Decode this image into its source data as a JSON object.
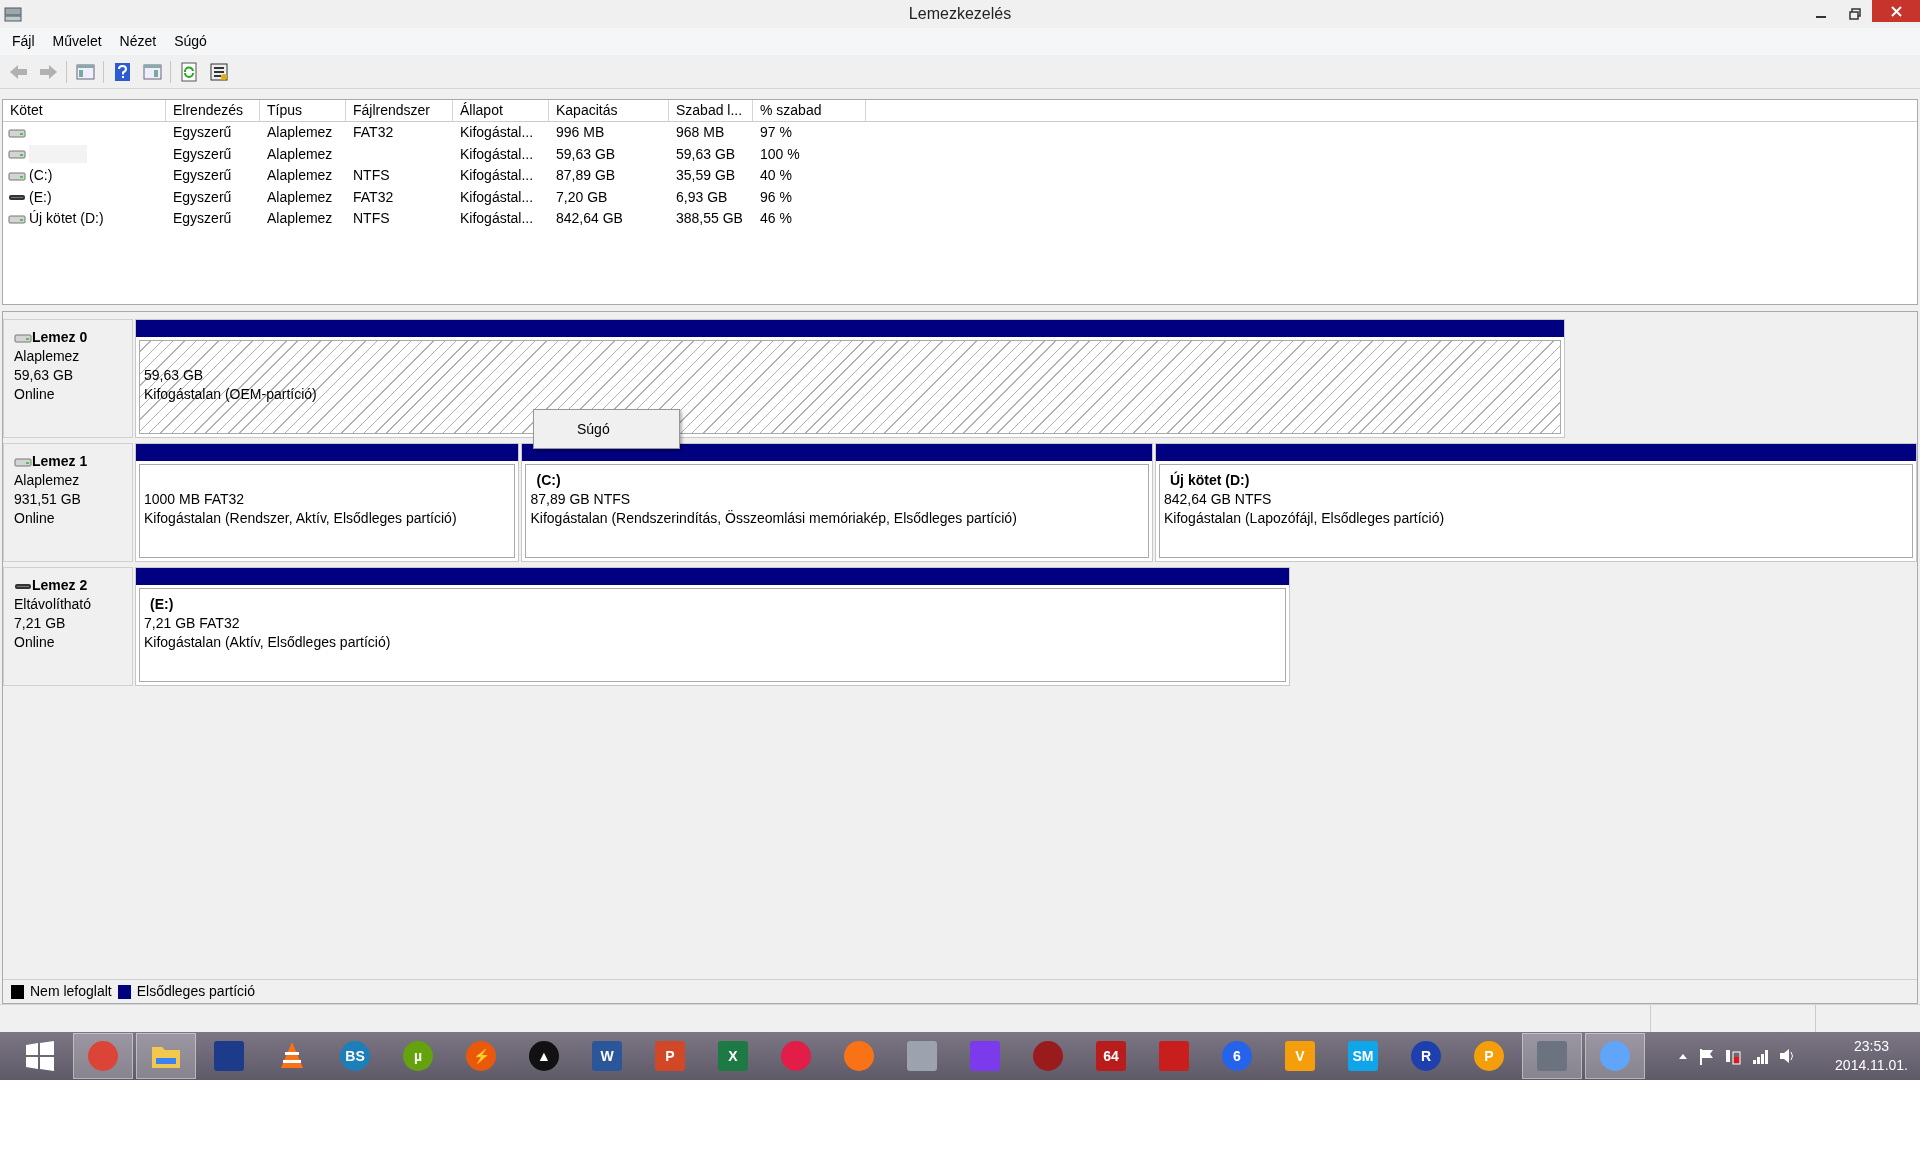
{
  "window": {
    "title": "Lemezkezelés"
  },
  "menu": [
    "Fájl",
    "Művelet",
    "Nézet",
    "Súgó"
  ],
  "toolbar": [
    {
      "kind": "back",
      "disabled": true
    },
    {
      "kind": "forward",
      "disabled": true
    },
    {
      "kind": "sep"
    },
    {
      "kind": "panel"
    },
    {
      "kind": "sep"
    },
    {
      "kind": "help"
    },
    {
      "kind": "panel2"
    },
    {
      "kind": "sep"
    },
    {
      "kind": "refresh"
    },
    {
      "kind": "properties"
    }
  ],
  "table": {
    "columns": [
      "Kötet",
      "Elrendezés",
      "Típus",
      "Fájlrendszer",
      "Állapot",
      "Kapacitás",
      "Szabad l...",
      "% szabad"
    ],
    "rows": [
      {
        "kind": "hdd",
        "redacted": false,
        "cells": [
          "",
          "Egyszerű",
          "Alaplemez",
          "FAT32",
          "Kifogástal...",
          "996 MB",
          "968 MB",
          "97 %"
        ]
      },
      {
        "kind": "hdd",
        "redacted": true,
        "cells": [
          "",
          "Egyszerű",
          "Alaplemez",
          "",
          "Kifogástal...",
          "59,63 GB",
          "59,63 GB",
          "100 %"
        ]
      },
      {
        "kind": "hdd",
        "redacted": false,
        "cells": [
          "(C:)",
          "Egyszerű",
          "Alaplemez",
          "NTFS",
          "Kifogástal...",
          "87,89 GB",
          "35,59 GB",
          "40 %"
        ]
      },
      {
        "kind": "removable",
        "redacted": false,
        "cells": [
          "(E:)",
          "Egyszerű",
          "Alaplemez",
          "FAT32",
          "Kifogástal...",
          "7,20 GB",
          "6,93 GB",
          "96 %"
        ]
      },
      {
        "kind": "hdd",
        "redacted": false,
        "cells": [
          "Új kötet (D:)",
          "Egyszerű",
          "Alaplemez",
          "NTFS",
          "Kifogástal...",
          "842,64 GB",
          "388,55 GB",
          "46 %"
        ]
      }
    ]
  },
  "disks": [
    {
      "kind": "hdd",
      "name": "Lemez 0",
      "type": "Alaplemez",
      "size": "59,63 GB",
      "status": "Online",
      "partitions": [
        {
          "selected": true,
          "size": "59,63 GB",
          "status": "Kifogástalan (OEM-partíció)"
        }
      ]
    },
    {
      "kind": "hdd",
      "name": "Lemez 1",
      "type": "Alaplemez",
      "size": "931,51 GB",
      "status": "Online",
      "partitions": [
        {
          "selected": false,
          "size": "1000 MB FAT32",
          "status": "Kifogástalan (Rendszer, Aktív, Elsődleges partíció)"
        },
        {
          "selected": false,
          "title": "(C:)",
          "size": "87,89 GB NTFS",
          "status": "Kifogástalan (Rendszerindítás, Összeomlási memóriakép, Elsődleges partíció)"
        },
        {
          "selected": false,
          "title": "Új kötet  (D:)",
          "size": "842,64 GB NTFS",
          "status": "Kifogástalan (Lapozófájl, Elsődleges partíció)"
        }
      ]
    },
    {
      "kind": "removable",
      "name": "Lemez 2",
      "type": "Eltávolítható",
      "size": "7,21 GB",
      "status": "Online",
      "partitions": [
        {
          "selected": false,
          "title": "(E:)",
          "size": "7,21 GB FAT32",
          "status": "Kifogástalan (Aktív, Elsődleges partíció)"
        }
      ]
    }
  ],
  "context_menu": {
    "items": [
      "Súgó"
    ]
  },
  "legend": [
    {
      "label": "Nem lefoglalt",
      "color": "#000000"
    },
    {
      "label": "Elsődleges partíció",
      "color": "#000080"
    }
  ],
  "taskbar": {
    "items": [
      {
        "kind": "windows",
        "running": false
      },
      {
        "kind": "circle",
        "color": "#db4437",
        "running": true
      },
      {
        "kind": "folder",
        "color": "#f2c94c",
        "running": true
      },
      {
        "kind": "square",
        "color": "#1e3a8a",
        "running": false
      },
      {
        "kind": "cone",
        "color": "#f97316",
        "running": false
      },
      {
        "kind": "circle",
        "color": "#1d7fb8",
        "label": "BS",
        "running": false
      },
      {
        "kind": "circle",
        "color": "#64a30d",
        "label": "µ",
        "running": false
      },
      {
        "kind": "circle",
        "color": "#ea580c",
        "label": "⚡",
        "running": false
      },
      {
        "kind": "circle",
        "color": "#111111",
        "label": "▲",
        "running": false
      },
      {
        "kind": "square",
        "color": "#2b579a",
        "label": "W",
        "running": false
      },
      {
        "kind": "square",
        "color": "#d24726",
        "label": "P",
        "running": false
      },
      {
        "kind": "square",
        "color": "#1d7a45",
        "label": "X",
        "running": false
      },
      {
        "kind": "circle",
        "color": "#e11d48",
        "running": false
      },
      {
        "kind": "circle",
        "color": "#f97316",
        "running": false
      },
      {
        "kind": "square",
        "color": "#9ca3af",
        "running": false
      },
      {
        "kind": "square",
        "color": "#7c3aed",
        "running": false
      },
      {
        "kind": "circle",
        "color": "#991b1b",
        "running": false
      },
      {
        "kind": "square",
        "color": "#b91c1c",
        "label": "64",
        "running": false
      },
      {
        "kind": "square",
        "color": "#c81e1e",
        "running": false
      },
      {
        "kind": "circle",
        "color": "#2563eb",
        "label": "6",
        "running": false
      },
      {
        "kind": "square",
        "color": "#f59e0b",
        "label": "V",
        "running": false
      },
      {
        "kind": "square",
        "color": "#0ea5e9",
        "label": "SM",
        "running": false
      },
      {
        "kind": "circle",
        "color": "#1e40af",
        "label": "R",
        "running": false
      },
      {
        "kind": "circle",
        "color": "#f59e0b",
        "label": "P",
        "running": false
      },
      {
        "kind": "square",
        "color": "#6b7280",
        "running": true
      },
      {
        "kind": "circle",
        "color": "#60a5fa",
        "running": true
      }
    ]
  },
  "tray": {
    "time": "23:53",
    "date": "2014.11.01."
  }
}
